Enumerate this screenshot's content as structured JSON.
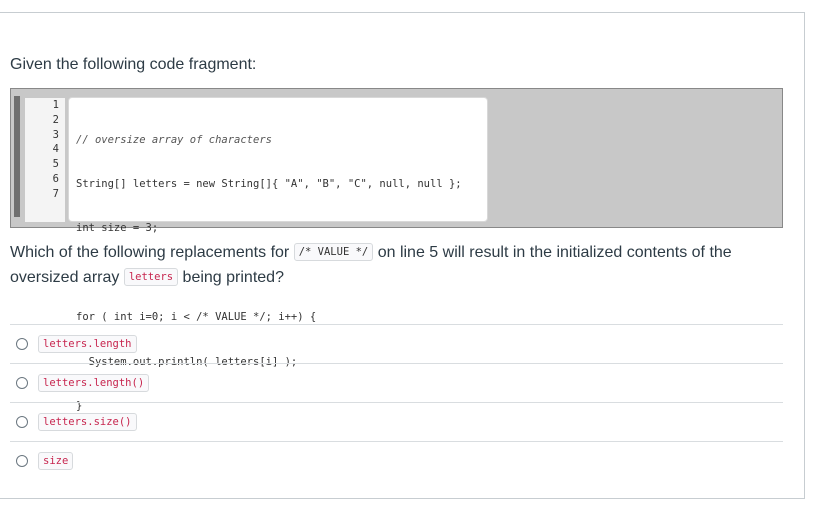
{
  "question": {
    "intro": "Given the following code fragment:",
    "line_numbers": [
      "1",
      "2",
      "3",
      "4",
      "5",
      "6",
      "7"
    ],
    "code_lines": [
      "// oversize array of characters",
      "String[] letters = new String[]{ \"A\", \"B\", \"C\", null, null };",
      "int size = 3;",
      "",
      "for ( int i=0; i < /* VALUE */; i++) {",
      "  System.out.println( letters[i] );",
      "}"
    ],
    "prompt_part1": "Which of the following replacements for",
    "prompt_code1": "/* VALUE */",
    "prompt_part2": "on line 5 will result in the initialized contents of the oversized array",
    "prompt_code2": "letters",
    "prompt_part3": "being printed?"
  },
  "answers": [
    {
      "label": "letters.length"
    },
    {
      "label": "letters.length()"
    },
    {
      "label": "letters.size()"
    },
    {
      "label": "size"
    }
  ],
  "colors": {
    "inline_code": "#c7254e",
    "text": "#2d3b45",
    "code_bg": "#c8c8c8"
  }
}
